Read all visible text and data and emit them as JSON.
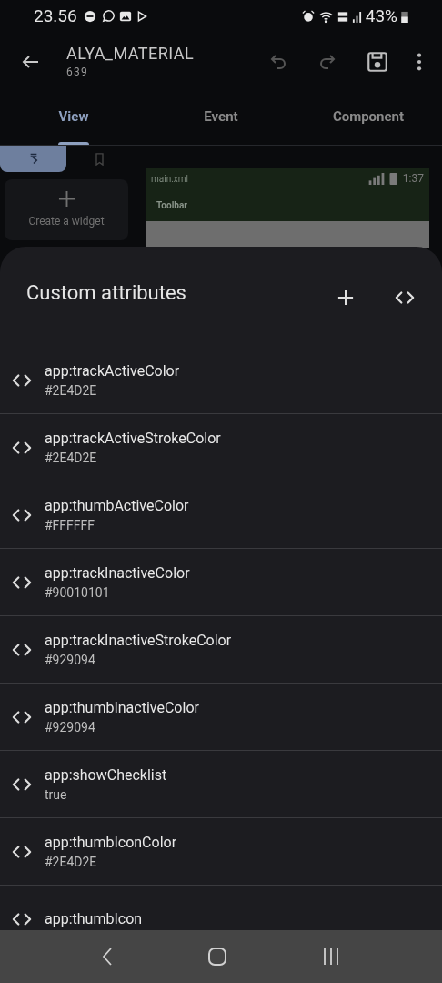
{
  "status_bar": {
    "time": "23.56",
    "battery": "43%"
  },
  "header": {
    "title": "ALYA_MATERIAL",
    "subtitle": "639"
  },
  "tabs": [
    {
      "label": "View",
      "selected": true
    },
    {
      "label": "Event",
      "selected": false
    },
    {
      "label": "Component",
      "selected": false
    }
  ],
  "palette_tabs": [
    {
      "selected": true
    },
    {
      "selected": false
    }
  ],
  "create_widget": {
    "label": "Create a widget"
  },
  "preview": {
    "file": "main.xml",
    "time": "1:37",
    "toolbar": "Toolbar"
  },
  "sheet": {
    "title": "Custom attributes",
    "attributes": [
      {
        "name": "app:trackActiveColor",
        "value": "#2E4D2E"
      },
      {
        "name": "app:trackActiveStrokeColor",
        "value": "#2E4D2E"
      },
      {
        "name": "app:thumbActiveColor",
        "value": "#FFFFFF"
      },
      {
        "name": "app:trackInactiveColor",
        "value": "#90010101"
      },
      {
        "name": "app:trackInactiveStrokeColor",
        "value": "#929094"
      },
      {
        "name": "app:thumbInactiveColor",
        "value": "#929094"
      },
      {
        "name": "app:showChecklist",
        "value": "true"
      },
      {
        "name": "app:thumbIconColor",
        "value": "#2E4D2E"
      },
      {
        "name": "app:thumbIcon"
      }
    ]
  }
}
